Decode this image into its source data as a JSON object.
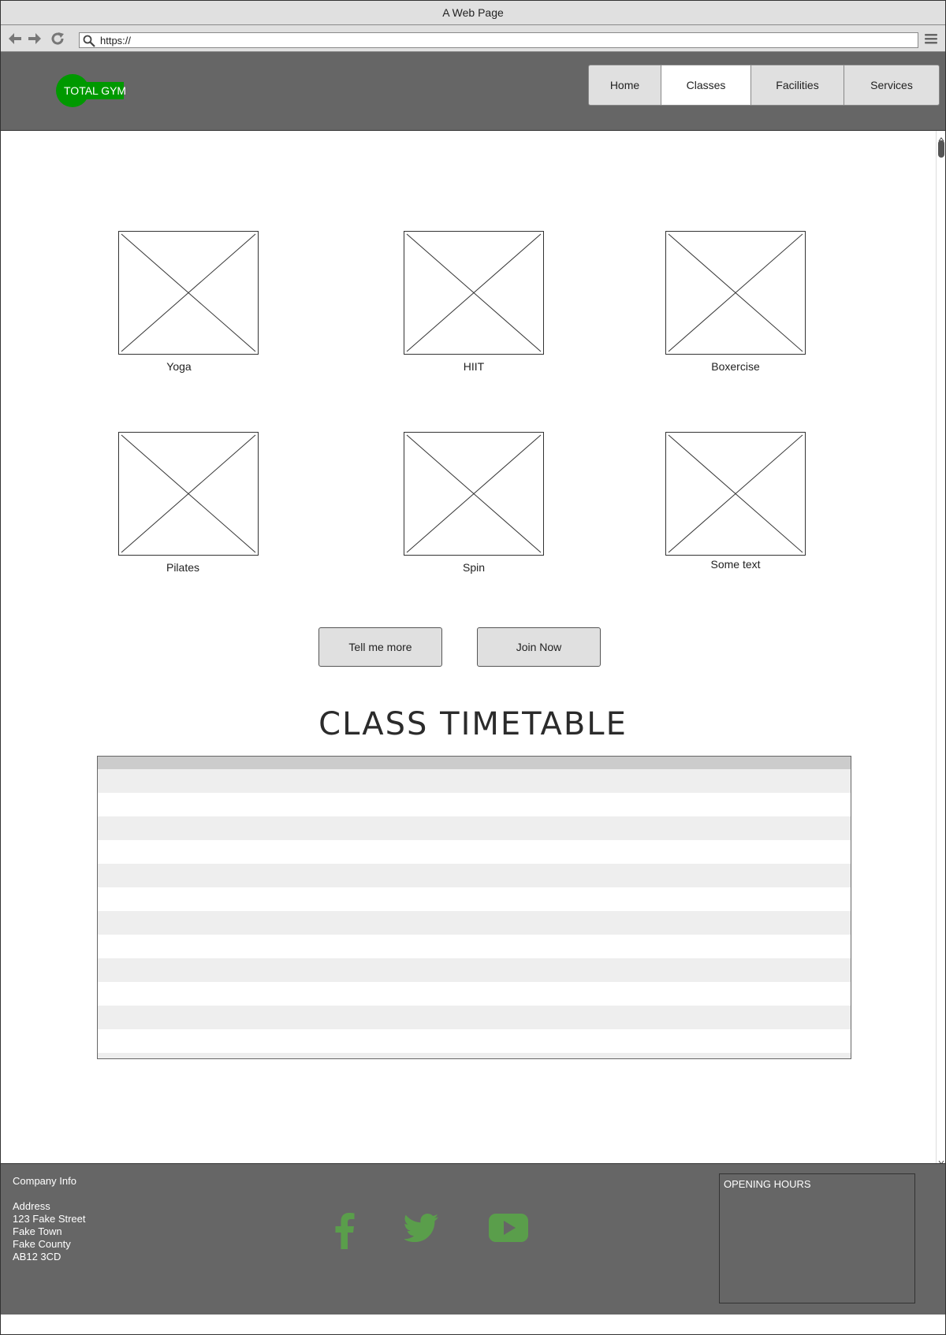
{
  "window": {
    "title": "A Web Page"
  },
  "browser": {
    "url": "https://"
  },
  "logo": {
    "text": "TOTAL GYM"
  },
  "nav": {
    "items": [
      {
        "label": "Home"
      },
      {
        "label": "Classes"
      },
      {
        "label": "Facilities"
      },
      {
        "label": "Services"
      }
    ],
    "active": "Classes"
  },
  "classes": [
    {
      "label": "Yoga"
    },
    {
      "label": "HIIT"
    },
    {
      "label": "Boxercise"
    },
    {
      "label": "Pilates"
    },
    {
      "label": "Spin"
    },
    {
      "label": "Some text"
    }
  ],
  "buttons": {
    "more": "Tell me more",
    "join": "Join Now"
  },
  "timetable": {
    "title": "CLASS TIMETABLE"
  },
  "footer": {
    "company_title": "Company Info",
    "address_label": "Address",
    "address_lines": [
      "123 Fake Street",
      "Fake Town",
      "Fake County",
      "AB12 3CD"
    ],
    "hours_title": "OPENING HOURS"
  },
  "colors": {
    "brand": "#009900",
    "header_bg": "#666666",
    "social": "#5a9e4b"
  },
  "icons": [
    "back-arrow-icon",
    "forward-arrow-icon",
    "reload-icon",
    "search-icon",
    "hamburger-menu-icon",
    "facebook-icon",
    "twitter-icon",
    "youtube-icon"
  ]
}
